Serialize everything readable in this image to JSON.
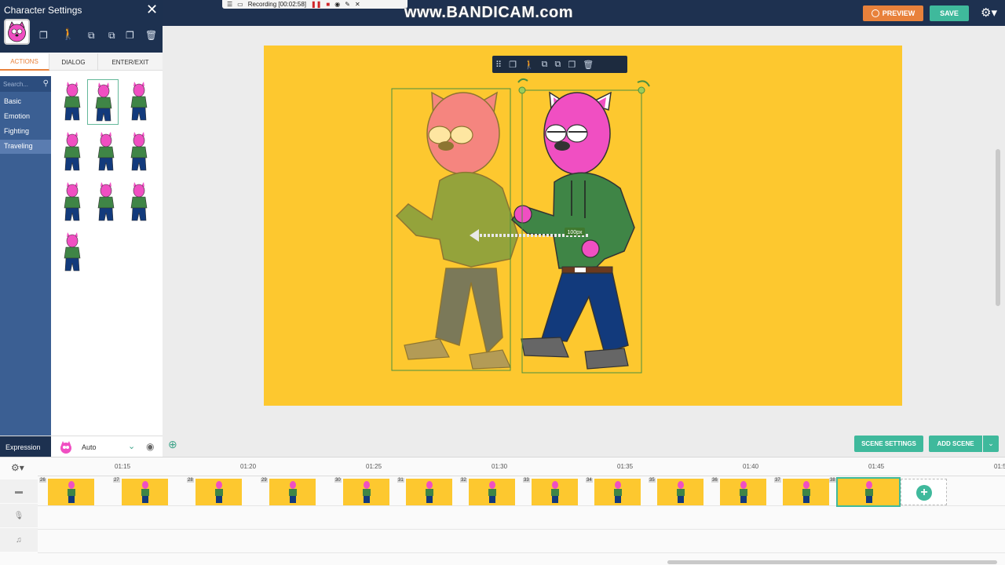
{
  "recording": {
    "text": "Recording [00:02:58]"
  },
  "watermark": "www.BANDICAM.com",
  "header": {
    "preview_label": "PREVIEW",
    "save_label": "SAVE"
  },
  "panel": {
    "title": "Character Settings",
    "tabs": [
      "ACTIONS",
      "DIALOG",
      "ENTER/EXIT"
    ],
    "search_placeholder": "Search...",
    "categories": [
      "Basic",
      "Emotion",
      "Fighting",
      "Traveling"
    ],
    "active_category": "Traveling",
    "expression_label": "Expression",
    "expression_value": "Auto"
  },
  "stage": {
    "distance_label": "100px"
  },
  "buttons": {
    "scene_settings": "SCENE SETTINGS",
    "add_scene": "ADD SCENE"
  },
  "timeline": {
    "ticks": [
      "01:15",
      "01:20",
      "01:25",
      "01:30",
      "01:35",
      "01:40",
      "01:45",
      "01:5"
    ],
    "clips": [
      "26",
      "27",
      "28",
      "29",
      "30",
      "31",
      "32",
      "33",
      "34",
      "35",
      "36",
      "37",
      "38"
    ]
  },
  "colors": {
    "accent_orange": "#e8813b",
    "accent_teal": "#3fb99c",
    "navy": "#1d3150",
    "stage_yellow": "#fdc82f",
    "character_pink": "#f04fc2",
    "hoodie_green": "#3f8546"
  }
}
